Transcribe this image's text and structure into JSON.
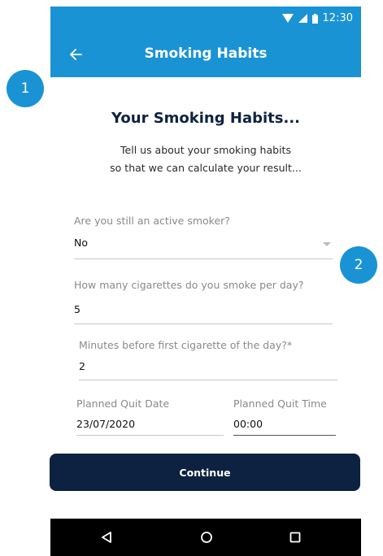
{
  "status_bar": {
    "time": "12:30"
  },
  "app_bar": {
    "title": "Smoking Habits",
    "back_icon": "arrow-left-icon"
  },
  "callouts": [
    "1",
    "2"
  ],
  "page": {
    "title": "Your Smoking Habits...",
    "subtitle_line1": "Tell us about your smoking habits",
    "subtitle_line2": "so that we can calculate your result..."
  },
  "form": {
    "active_smoker": {
      "label": "Are you still an active smoker?",
      "value": "No"
    },
    "cigarettes_per_day": {
      "label": "How many cigarettes do you smoke per day?",
      "value": "5"
    },
    "minutes_before_first": {
      "label": "Minutes before first cigarette of the day?*",
      "value": "2"
    },
    "planned_quit_date": {
      "label": "Planned Quit Date",
      "value": "23/07/2020"
    },
    "planned_quit_time": {
      "label": "Planned Quit Time",
      "value": "00:00"
    }
  },
  "continue_label": "Continue",
  "colors": {
    "primary": "#1a93d5",
    "navy": "#0d2240"
  }
}
